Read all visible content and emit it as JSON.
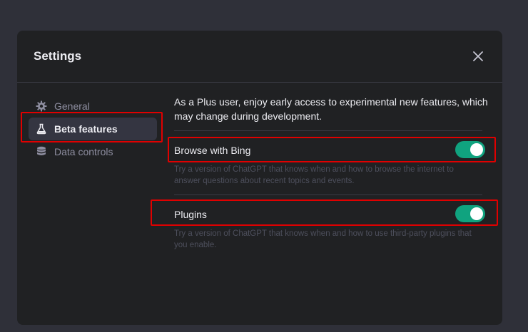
{
  "modal": {
    "title": "Settings"
  },
  "sidebar": {
    "items": [
      {
        "label": "General",
        "icon": "gear-icon",
        "active": false
      },
      {
        "label": "Beta features",
        "icon": "flask-icon",
        "active": true
      },
      {
        "label": "Data controls",
        "icon": "database-icon",
        "active": false
      }
    ]
  },
  "content": {
    "intro": "As a Plus user, enjoy early access to experimental new features, which may change during development.",
    "settings": [
      {
        "title": "Browse with Bing",
        "description": "Try a version of ChatGPT that knows when and how to browse the internet to answer questions about recent topics and events.",
        "enabled": true
      },
      {
        "title": "Plugins",
        "description": "Try a version of ChatGPT that knows when and how to use third-party plugins that you enable.",
        "enabled": true
      }
    ]
  },
  "colors": {
    "accent": "#10a37f",
    "highlight": "#e00000",
    "modal_bg": "#202123"
  }
}
